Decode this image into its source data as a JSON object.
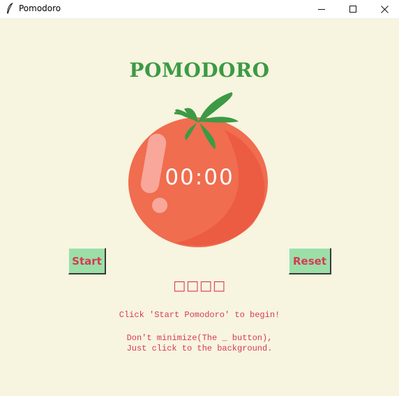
{
  "window": {
    "title": "Pomodoro",
    "controls": [
      "minimize",
      "maximize",
      "close"
    ]
  },
  "app": {
    "heading": "POMODORO",
    "timer": "00:00",
    "checkmarks": "□□□□",
    "buttons": {
      "start": "Start",
      "reset": "Reset"
    },
    "messages": {
      "line1": "Click 'Start Pomodoro' to begin!",
      "line2": "Don't minimize(The _ button),",
      "line3": "Just click to the background."
    }
  },
  "colors": {
    "background": "#f7f4df",
    "heading_green": "#3c9a45",
    "text_red": "#d63a55",
    "button_green": "#9bdfa7",
    "tomato": "#f06d4f"
  },
  "icons": {
    "app": "feather-icon",
    "minimize": "minimize-icon",
    "maximize": "maximize-icon",
    "close": "close-icon",
    "tomato": "tomato-image"
  }
}
